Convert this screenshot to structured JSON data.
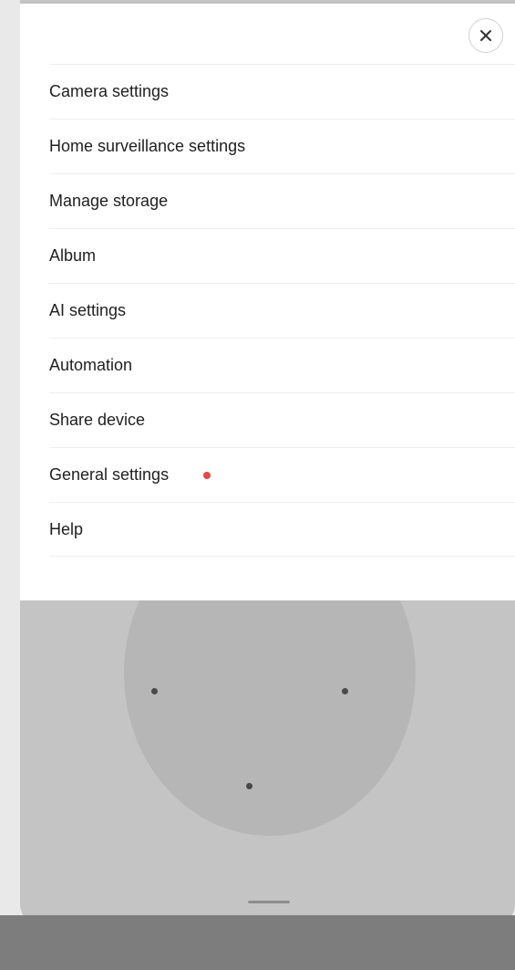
{
  "menu": {
    "close_icon": "close-icon",
    "items": [
      {
        "label": "Camera settings"
      },
      {
        "label": "Home surveillance settings"
      },
      {
        "label": "Manage storage"
      },
      {
        "label": "Album"
      },
      {
        "label": "AI settings"
      },
      {
        "label": "Automation"
      },
      {
        "label": "Share device"
      },
      {
        "label": "General settings",
        "has_notification": true
      },
      {
        "label": "Help"
      }
    ]
  },
  "colors": {
    "notification_dot": "#e64545",
    "sheet_background": "#ffffff",
    "backdrop": "#c4c4c4"
  }
}
